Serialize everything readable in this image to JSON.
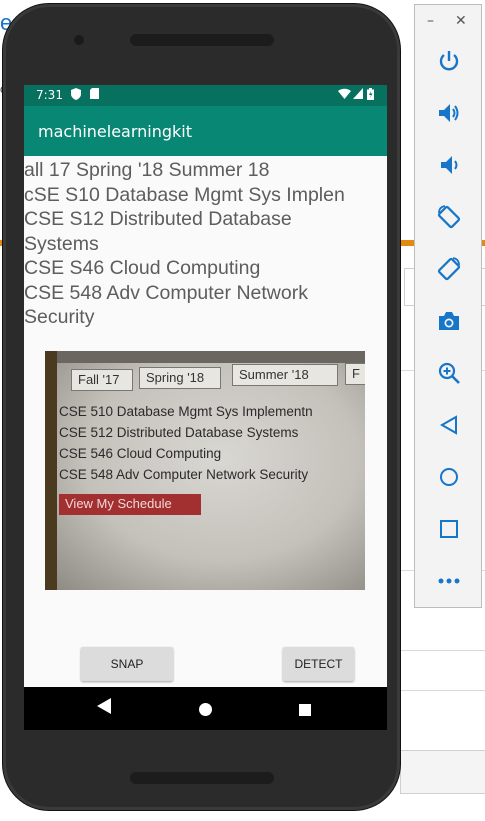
{
  "background": {
    "title_fragment": "e",
    "left_fragment": "c",
    "right_fragment_1": "si",
    "right_fragment_2": "s"
  },
  "status_bar": {
    "time": "7:31"
  },
  "app_bar": {
    "title": "machinelearningkit"
  },
  "result_text": "all 17 Spring '18 Summer 18\ncSE S10 Database Mgmt Sys Implen\nCSE S12 Distributed Database\nSystems\nCSE S46 Cloud Computing\nCSE 548 Adv Computer Network\nSecurity",
  "camera_preview": {
    "tabs": [
      "Fall '17",
      "Spring '18",
      "Summer '18",
      "F"
    ],
    "lines": [
      "CSE 510 Database Mgmt Sys Implementn",
      "CSE 512 Distributed Database Systems",
      "CSE 546 Cloud Computing",
      "CSE 548 Adv Computer Network Security"
    ],
    "button": "View My Schedule"
  },
  "buttons": {
    "snap": "SNAP",
    "detect": "DETECT"
  },
  "emulator_toolbar": {
    "tools": [
      "power-icon",
      "volume-up-icon",
      "volume-down-icon",
      "rotate-left-icon",
      "rotate-right-icon",
      "camera-icon",
      "zoom-in-icon",
      "back-icon",
      "home-icon",
      "overview-icon",
      "more-icon"
    ]
  },
  "colors": {
    "status_bar": "#07705f",
    "app_bar": "#078774",
    "toolbar_icon": "#1776c8"
  }
}
